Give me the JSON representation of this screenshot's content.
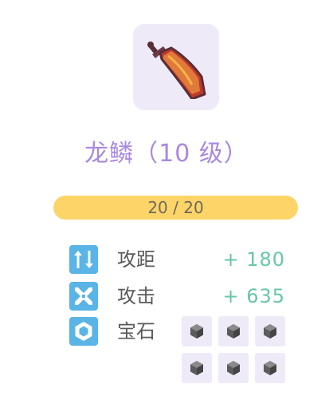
{
  "item": {
    "icon": "dragon-scale-sword-icon",
    "title": "龙鳞（10 级）"
  },
  "level_progress": {
    "text": "20 / 20",
    "current": 20,
    "max": 20
  },
  "stats": [
    {
      "icon": "range-arrows-icon",
      "label": "攻距",
      "value": "+ 180"
    },
    {
      "icon": "crossed-swords-icon",
      "label": "攻击",
      "value": "+ 635"
    },
    {
      "icon": "hexagon-gem-icon",
      "label": "宝石"
    }
  ],
  "gem_slots": [
    {
      "state": "empty",
      "icon": "gray-gem-icon"
    },
    {
      "state": "empty",
      "icon": "gray-gem-icon"
    },
    {
      "state": "empty",
      "icon": "gray-gem-icon"
    },
    {
      "state": "empty",
      "icon": "gray-gem-icon"
    },
    {
      "state": "empty",
      "icon": "gray-gem-icon"
    },
    {
      "state": "empty",
      "icon": "gray-gem-icon"
    }
  ],
  "colors": {
    "title": "#a889e0",
    "progress_fill": "#fcd468",
    "stat_icon_bg": "#5ab4e6",
    "stat_value": "#67c7a3",
    "tile_bg": "#efeaf8"
  }
}
